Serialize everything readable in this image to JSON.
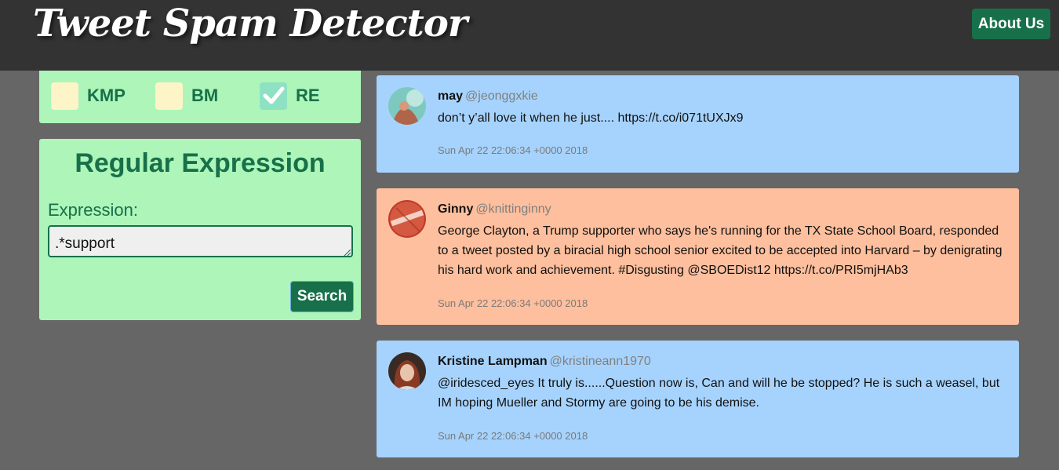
{
  "app": {
    "title": "Tweet Spam Detector",
    "about_label": "About Us"
  },
  "algorithms": [
    {
      "label": "KMP",
      "checked": false
    },
    {
      "label": "BM",
      "checked": false
    },
    {
      "label": "RE",
      "checked": true
    }
  ],
  "search_panel": {
    "title": "Regular Expression",
    "field_label": "Expression:",
    "value": ".*support",
    "button_label": "Search"
  },
  "tweets": [
    {
      "name": "may",
      "handle": "@jeonggxkie",
      "text": "don’t y’all love it when he just.... https://t.co/i071tUXJx9",
      "time": "Sun Apr 22 22:06:34 +0000 2018",
      "spam": false
    },
    {
      "name": "Ginny",
      "handle": "@knittinginny",
      "text": "George Clayton, a Trump supporter who says he's running for the TX State School Board, responded to a tweet posted by a biracial high school senior excited to be accepted into Harvard – by denigrating his hard work and achievement. #Disgusting @SBOEDist12 https://t.co/PRI5mjHAb3",
      "time": "Sun Apr 22 22:06:34 +0000 2018",
      "spam": true
    },
    {
      "name": "Kristine Lampman",
      "handle": "@kristineann1970",
      "text": "@iridesced_eyes It truly is......Question now is, Can and will he be stopped? He is such a weasel, but IM hoping Mueller and Stormy are going to be his demise.",
      "time": "Sun Apr 22 22:06:34 +0000 2018",
      "spam": false
    }
  ],
  "colors": {
    "header_bg": "#333333",
    "page_bg": "#666666",
    "panel_bg": "#adf5b8",
    "accent_green": "#17704a",
    "ham_tweet_bg": "#a6d3fd",
    "spam_tweet_bg": "#fdbf9d"
  },
  "icons": {
    "checkmark": "check-icon"
  }
}
